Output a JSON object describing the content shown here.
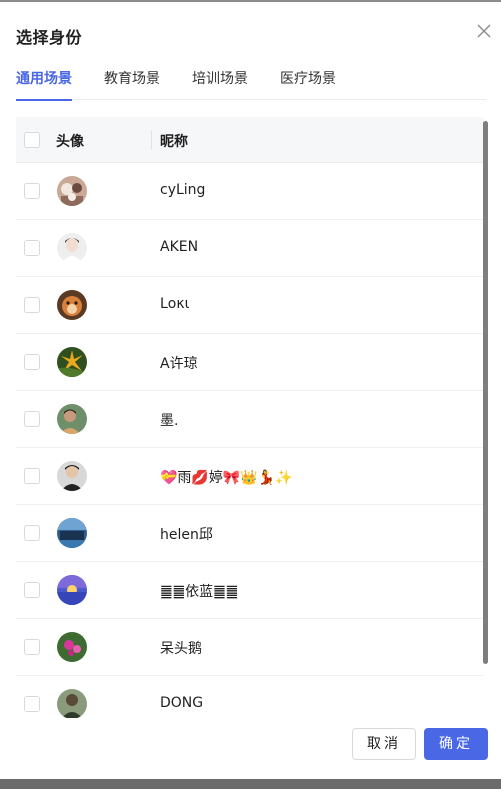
{
  "dialog": {
    "title": "选择身份",
    "close_icon": "close-icon"
  },
  "tabs": [
    {
      "label": "通用场景",
      "active": true
    },
    {
      "label": "教育场景",
      "active": false
    },
    {
      "label": "培训场景",
      "active": false
    },
    {
      "label": "医疗场景",
      "active": false
    }
  ],
  "table": {
    "headers": {
      "avatar": "头像",
      "nickname": "昵称"
    },
    "rows": [
      {
        "nickname": "cyLing"
      },
      {
        "nickname": "AKEN"
      },
      {
        "nickname": "Lοκι"
      },
      {
        "nickname": "A许琼"
      },
      {
        "nickname": "墨."
      },
      {
        "nickname": "💝雨💋婷🎀👑💃✨"
      },
      {
        "nickname": "helen邱"
      },
      {
        "nickname": "䷀䷀依蓝䷀䷀"
      },
      {
        "nickname": "呆头鹅"
      },
      {
        "nickname": "DONG"
      }
    ]
  },
  "footer": {
    "cancel_label": "取消",
    "ok_label": "确定"
  },
  "colors": {
    "accent": "#4a67e6",
    "header_bg": "#f6f7f9"
  }
}
